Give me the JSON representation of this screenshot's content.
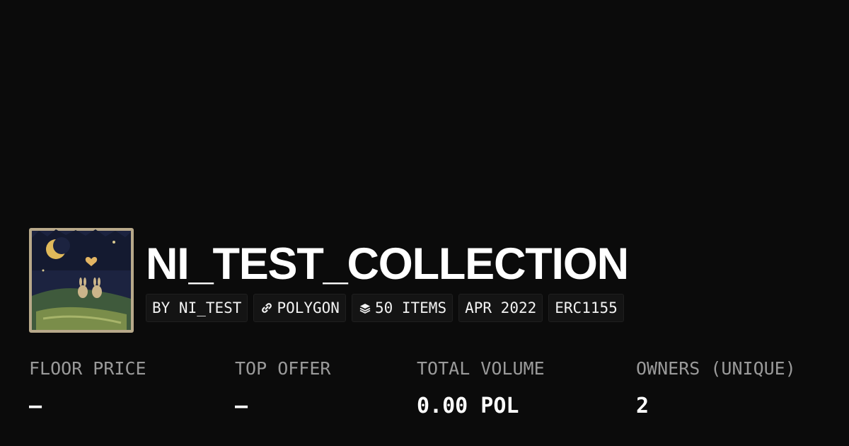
{
  "collection": {
    "name": "NI_TEST_COLLECTION",
    "thumbnail_icon": "collection-artwork-moon-bunnies"
  },
  "badges": [
    {
      "icon": "",
      "label": "BY NI_TEST"
    },
    {
      "icon": "chain-link-icon",
      "label": "POLYGON"
    },
    {
      "icon": "layers-icon",
      "label": "50 ITEMS"
    },
    {
      "icon": "",
      "label": "APR 2022"
    },
    {
      "icon": "",
      "label": "ERC1155"
    }
  ],
  "stats": [
    {
      "label": "FLOOR PRICE",
      "value": "–"
    },
    {
      "label": "TOP OFFER",
      "value": "–"
    },
    {
      "label": "TOTAL VOLUME",
      "value": "0.00 POL"
    },
    {
      "label": "OWNERS (UNIQUE)",
      "value": "2"
    }
  ],
  "colors": {
    "background": "#0b0b0b",
    "badge_background": "#141414",
    "text_primary": "#ffffff",
    "text_muted": "#9a9a9a"
  }
}
